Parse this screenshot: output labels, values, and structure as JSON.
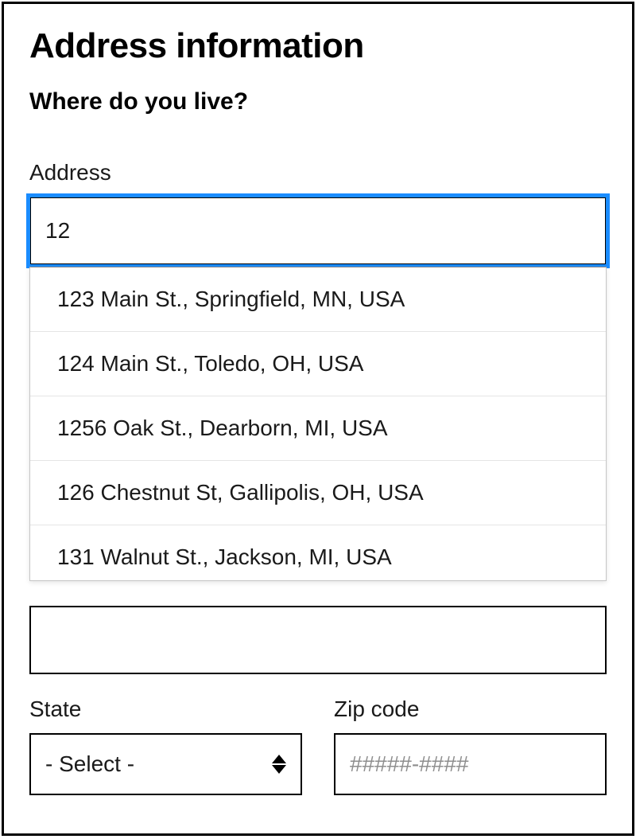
{
  "title": "Address information",
  "subtitle": "Where do you live?",
  "address": {
    "label": "Address",
    "value": "12",
    "suggestions": [
      "123 Main St., Springfield, MN, USA",
      "124 Main St., Toledo, OH, USA",
      "1256 Oak St., Dearborn, MI, USA",
      "126 Chestnut St, Gallipolis, OH, USA",
      "131 Walnut St., Jackson, MI, USA"
    ]
  },
  "state": {
    "label": "State",
    "selected": "- Select -"
  },
  "zip": {
    "label": "Zip code",
    "placeholder": "#####-####",
    "value": ""
  }
}
